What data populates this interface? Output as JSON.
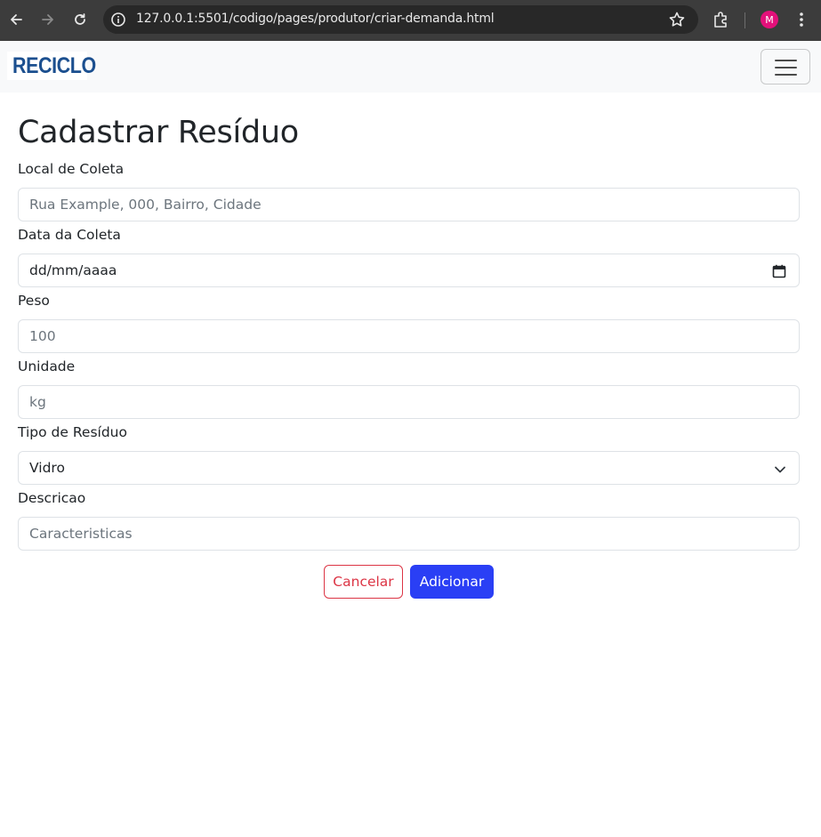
{
  "browser": {
    "url": "127.0.0.1:5501/codigo/pages/produtor/criar-demanda.html",
    "profile_initial": "M",
    "icons": [
      "back-arrow-icon",
      "forward-arrow-icon",
      "reload-icon",
      "site-info-icon",
      "bookmark-star-icon",
      "extensions-icon",
      "profile-avatar",
      "kebab-menu-icon"
    ]
  },
  "navbar": {
    "logo_text": "RECICLO",
    "toggler_icon": "hamburger-menu-icon"
  },
  "page": {
    "title": "Cadastrar Resíduo"
  },
  "form": {
    "local": {
      "label": "Local de Coleta",
      "placeholder": "Rua Example, 000, Bairro, Cidade",
      "value": ""
    },
    "data": {
      "label": "Data da Coleta",
      "value": "dd/mm/aaaa"
    },
    "peso": {
      "label": "Peso",
      "placeholder": "100",
      "value": ""
    },
    "unidade": {
      "label": "Unidade",
      "placeholder": "kg",
      "value": ""
    },
    "tipo": {
      "label": "Tipo de Resíduo",
      "selected": "Vidro"
    },
    "descricao": {
      "label": "Descricao",
      "placeholder": "Caracteristicas",
      "value": ""
    }
  },
  "actions": {
    "cancel_label": "Cancelar",
    "add_label": "Adicionar"
  },
  "colors": {
    "brand": "#1b4f8f",
    "primary": "#2a3ff5",
    "danger": "#dc3545",
    "chrome": "#3c3c3c"
  }
}
